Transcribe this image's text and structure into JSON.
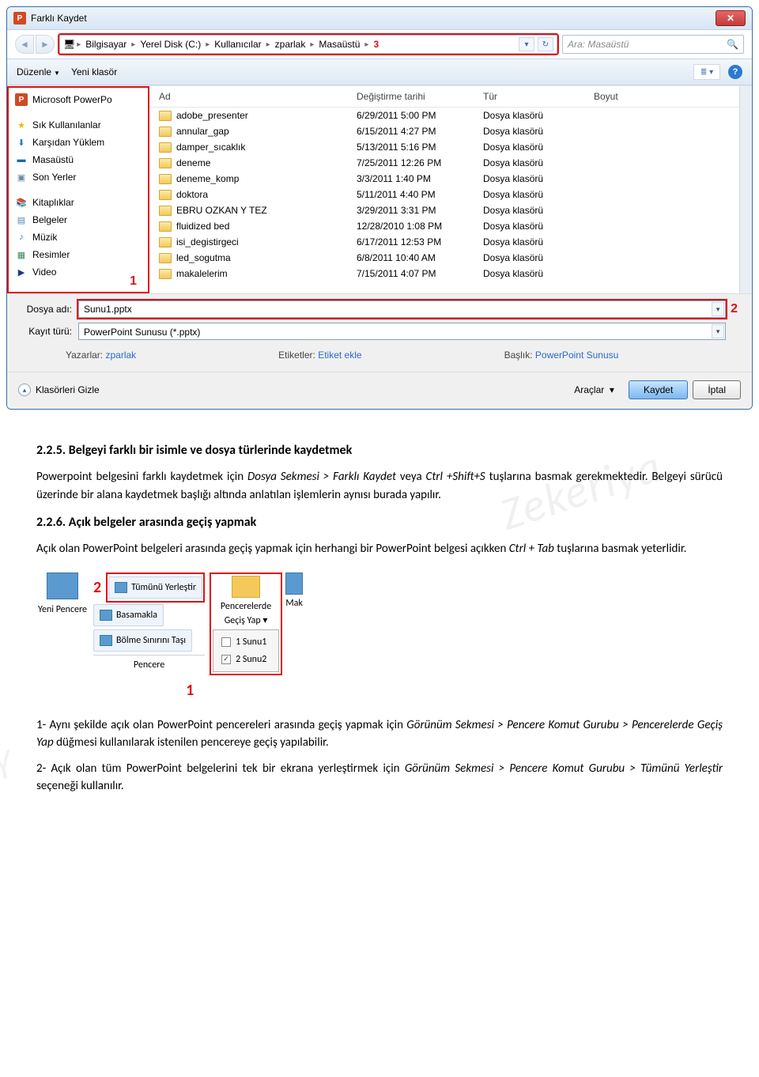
{
  "dialog": {
    "title": "Farklı Kaydet",
    "breadcrumb": [
      "Bilgisayar",
      "Yerel Disk (C:)",
      "Kullanıcılar",
      "zparlak",
      "Masaüstü"
    ],
    "breadcrumb_marker": "3",
    "search_placeholder": "Ara: Masaüstü",
    "toolbar": {
      "organize": "Düzenle",
      "newfolder": "Yeni klasör"
    },
    "sidebar": {
      "items": [
        {
          "icon": "pp",
          "label": "Microsoft PowerPo"
        },
        {
          "icon": "star",
          "label": "Sık Kullanılanlar"
        },
        {
          "icon": "dl",
          "label": "Karşıdan Yüklem"
        },
        {
          "icon": "desk",
          "label": "Masaüstü"
        },
        {
          "icon": "recent",
          "label": "Son Yerler"
        },
        {
          "icon": "lib",
          "label": "Kitaplıklar"
        },
        {
          "icon": "doc",
          "label": "Belgeler"
        },
        {
          "icon": "music",
          "label": "Müzik"
        },
        {
          "icon": "pic",
          "label": "Resimler"
        },
        {
          "icon": "vid",
          "label": "Video"
        }
      ],
      "marker": "1"
    },
    "columns": {
      "name": "Ad",
      "modified": "Değiştirme tarihi",
      "type": "Tür",
      "size": "Boyut"
    },
    "rows": [
      {
        "name": "adobe_presenter",
        "date": "6/29/2011 5:00 PM",
        "type": "Dosya klasörü"
      },
      {
        "name": "annular_gap",
        "date": "6/15/2011 4:27 PM",
        "type": "Dosya klasörü"
      },
      {
        "name": "damper_sıcaklık",
        "date": "5/13/2011 5:16 PM",
        "type": "Dosya klasörü"
      },
      {
        "name": "deneme",
        "date": "7/25/2011 12:26 PM",
        "type": "Dosya klasörü"
      },
      {
        "name": "deneme_komp",
        "date": "3/3/2011 1:40 PM",
        "type": "Dosya klasörü"
      },
      {
        "name": "doktora",
        "date": "5/11/2011 4:40 PM",
        "type": "Dosya klasörü"
      },
      {
        "name": "EBRU OZKAN Y TEZ",
        "date": "3/29/2011 3:31 PM",
        "type": "Dosya klasörü"
      },
      {
        "name": "fluidized bed",
        "date": "12/28/2010 1:08 PM",
        "type": "Dosya klasörü"
      },
      {
        "name": "isi_degistirgeci",
        "date": "6/17/2011 12:53 PM",
        "type": "Dosya klasörü"
      },
      {
        "name": "led_sogutma",
        "date": "6/8/2011 10:40 AM",
        "type": "Dosya klasörü"
      },
      {
        "name": "makalelerim",
        "date": "7/15/2011 4:07 PM",
        "type": "Dosya klasörü"
      }
    ],
    "filename_label": "Dosya adı:",
    "filename_value": "Sunu1.pptx",
    "filename_marker": "2",
    "type_label": "Kayıt türü:",
    "type_value": "PowerPoint Sunusu (*.pptx)",
    "meta": {
      "authors_l": "Yazarlar:",
      "authors_v": "zparlak",
      "tags_l": "Etiketler:",
      "tags_v": "Etiket ekle",
      "title_l": "Başlık:",
      "title_v": "PowerPoint Sunusu"
    },
    "hide": "Klasörleri Gizle",
    "tools": "Araçlar",
    "save": "Kaydet",
    "cancel": "İptal"
  },
  "doc": {
    "h1": "2.2.5. Belgeyi farklı bir isimle ve dosya türlerinde kaydetmek",
    "p1a": "Powerpoint belgesini farklı kaydetmek için ",
    "p1b": "Dosya Sekmesi > Farklı Kaydet",
    "p1c": " veya  ",
    "p1d": "Ctrl +Shift+S",
    "p1e": " tuşlarına basmak gerekmektedir. Belgeyi sürücü üzerinde bir alana kaydetmek başlığı altında anlatılan işlemlerin aynısı burada yapılır.",
    "h2": "2.2.6. Açık belgeler arasında geçiş yapmak",
    "p2a": "Açık olan PowerPoint belgeleri arasında geçiş yapmak için herhangi bir PowerPoint belgesi açıkken ",
    "p2b": "Ctrl + Tab",
    "p2c": " tuşlarına basmak yeterlidir.",
    "ribbon": {
      "new_window": "Yeni Pencere",
      "arrange_all": "Tümünü Yerleştir",
      "cascade": "Basamakla",
      "move_split": "Bölme Sınırını Taşı",
      "group": "Pencere",
      "switch": "Pencerelerde Geçiş Yap",
      "mak": "Mak",
      "item1": "1 Sunu1",
      "item2": "2 Sunu2",
      "m1": "1",
      "m2": "2"
    },
    "p3a": "1- Aynı şekilde açık olan PowerPoint pencereleri arasında geçiş yapmak için ",
    "p3b": "Görünüm Sekmesi > Pencere Komut Gurubu > Pencerelerde Geçiş Yap",
    "p3c": " düğmesi kullanılarak istenilen pencereye geçiş yapılabilir.",
    "p4a": "2- Açık olan tüm PowerPoint belgelerini tek bir ekrana yerleştirmek için ",
    "p4b": "Görünüm Sekmesi > Pencere Komut Gurubu > Tümünü Yerleştir",
    "p4c": " seçeneği kullanılır."
  }
}
